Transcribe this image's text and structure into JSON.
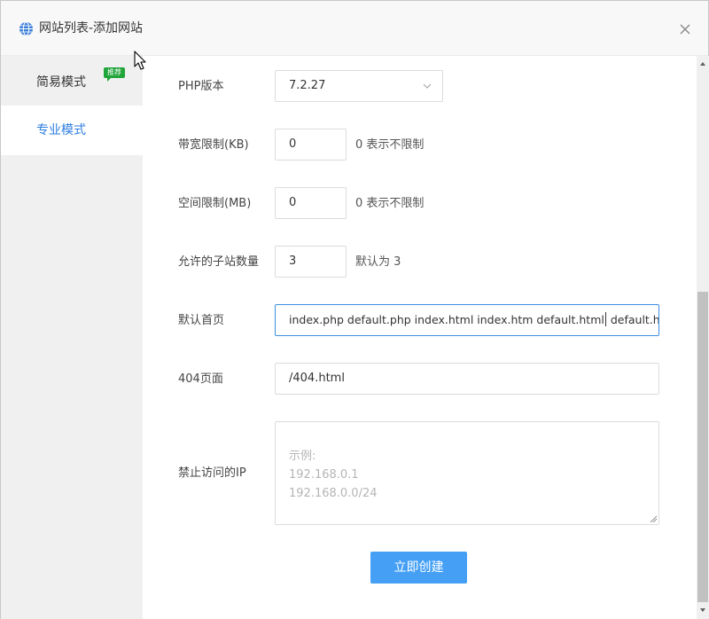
{
  "window": {
    "title": "网站列表-添加网站",
    "title_icon": "globe-icon",
    "close_icon": "close-icon"
  },
  "sidebar": {
    "items": [
      {
        "label": "简易模式",
        "badge": "推荐",
        "active": false
      },
      {
        "label": "专业模式",
        "active": true
      }
    ]
  },
  "form": {
    "php_version": {
      "label": "PHP版本",
      "value": "7.2.27"
    },
    "bandwidth": {
      "label": "带宽限制(KB)",
      "value": "0",
      "hint": "0 表示不限制"
    },
    "space": {
      "label": "空间限制(MB)",
      "value": "0",
      "hint": "0 表示不限制"
    },
    "subsites": {
      "label": "允许的子站数量",
      "value": "3",
      "hint": "默认为 3"
    },
    "default_index": {
      "label": "默认首页",
      "value_before_caret": "index.php default.php index.html index.htm default.html",
      "value_after_caret": " default.h"
    },
    "page_404": {
      "label": "404页面",
      "value": "/404.html"
    },
    "blocked_ip": {
      "label": "禁止访问的IP",
      "placeholder_lines": [
        "示例:",
        "192.168.0.1",
        "192.168.0.0/24"
      ]
    },
    "submit_label": "立即创建"
  },
  "colors": {
    "accent": "#45a0f5",
    "active_tab_text": "#2c7de0",
    "badge": "#20a53a",
    "sidebar_bg": "#f0f0f0"
  }
}
